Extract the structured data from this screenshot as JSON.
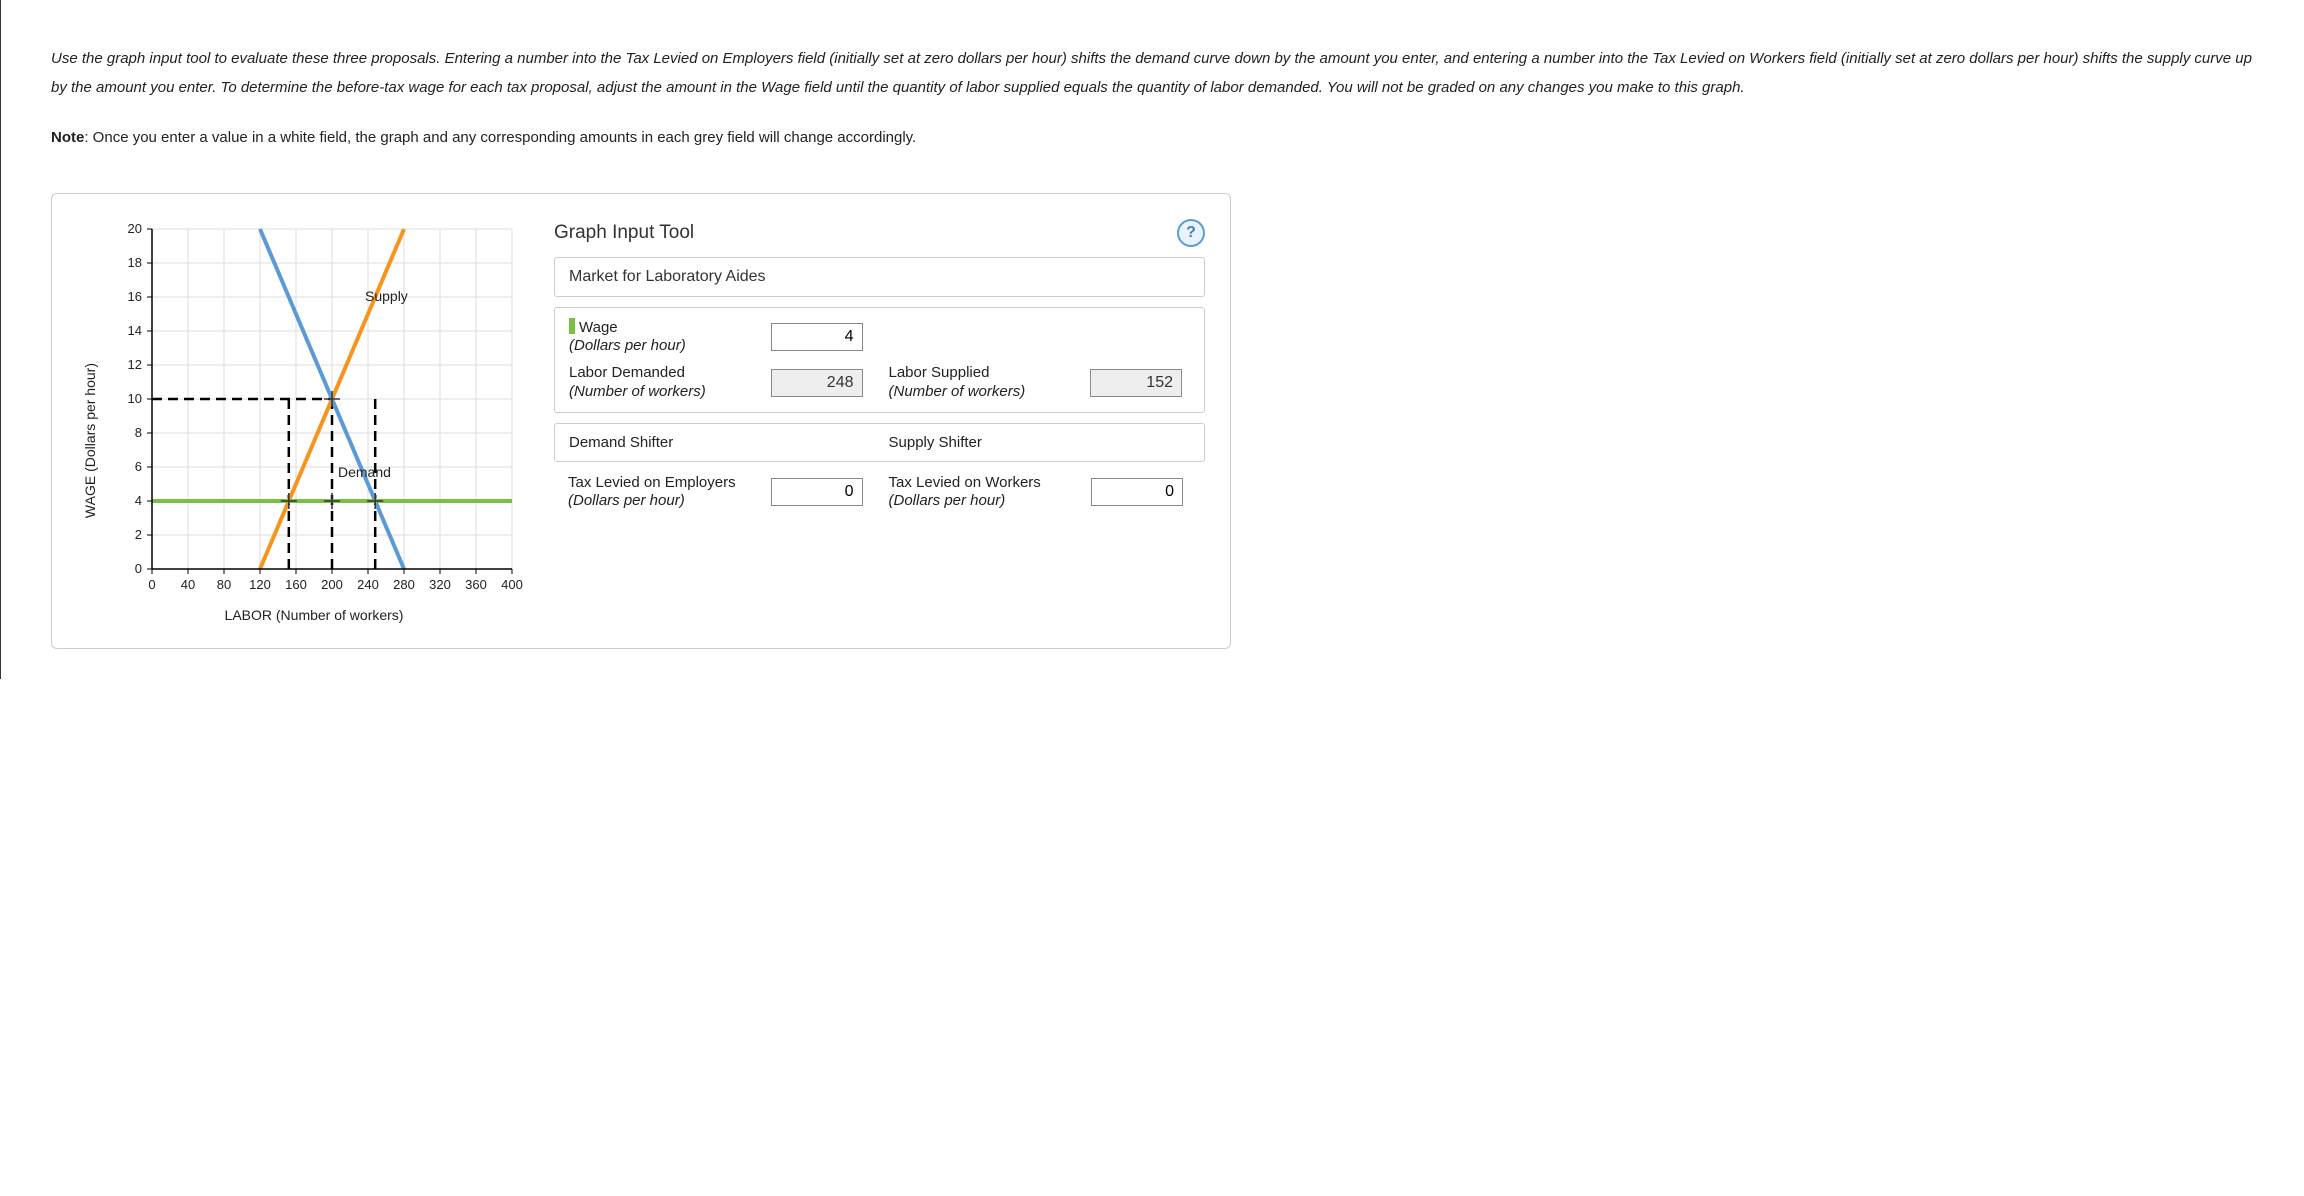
{
  "instructions": "Use the graph input tool to evaluate these three proposals. Entering a number into the Tax Levied on Employers field (initially set at zero dollars per hour) shifts the demand curve down by the amount you enter, and entering a number into the Tax Levied on Workers field (initially set at zero dollars per hour) shifts the supply curve up by the amount you enter. To determine the before-tax wage for each tax proposal, adjust the amount in the Wage field until the quantity of labor supplied equals the quantity of labor demanded. You will not be graded on any changes you make to this graph.",
  "note_label": "Note",
  "note_body": ": Once you enter a value in a white field, the graph and any corresponding amounts in each grey field will change accordingly.",
  "panel": {
    "title": "Graph Input Tool",
    "help": "?",
    "market_title": "Market for Laboratory Aides",
    "wage_label": "Wage",
    "wage_sub": "(Dollars per hour)",
    "wage_value": "4",
    "labor_demanded_label": "Labor Demanded",
    "labor_demanded_sub": "(Number of workers)",
    "labor_demanded_value": "248",
    "labor_supplied_label": "Labor Supplied",
    "labor_supplied_sub": "(Number of workers)",
    "labor_supplied_value": "152",
    "demand_shifter_title": "Demand Shifter",
    "supply_shifter_title": "Supply Shifter",
    "tax_employers_label": "Tax Levied on Employers",
    "tax_employers_sub": "(Dollars per hour)",
    "tax_employers_value": "0",
    "tax_workers_label": "Tax Levied on Workers",
    "tax_workers_sub": "(Dollars per hour)",
    "tax_workers_value": "0"
  },
  "chart_data": {
    "type": "line",
    "title": "",
    "xlabel": "LABOR (Number of workers)",
    "ylabel": "WAGE (Dollars per hour)",
    "xlim": [
      0,
      400
    ],
    "ylim": [
      0,
      20
    ],
    "x_ticks": [
      0,
      40,
      80,
      120,
      160,
      200,
      240,
      280,
      320,
      360,
      400
    ],
    "y_ticks": [
      0,
      2,
      4,
      6,
      8,
      10,
      12,
      14,
      16,
      18,
      20
    ],
    "series": [
      {
        "name": "Supply",
        "color": "#f7941d",
        "points": [
          [
            120,
            0
          ],
          [
            280,
            20
          ]
        ]
      },
      {
        "name": "Demand",
        "color": "#5b9bd5",
        "points": [
          [
            120,
            20
          ],
          [
            280,
            0
          ]
        ]
      },
      {
        "name": "Wage",
        "color": "#7ac142",
        "points": [
          [
            0,
            4
          ],
          [
            400,
            4
          ]
        ]
      }
    ],
    "equilibrium": {
      "x": 200,
      "y": 10
    },
    "guide_dashes": [
      {
        "from": [
          0,
          10
        ],
        "to": [
          200,
          10
        ]
      },
      {
        "from": [
          152,
          0
        ],
        "to": [
          152,
          10
        ]
      },
      {
        "from": [
          200,
          0
        ],
        "to": [
          200,
          10
        ]
      },
      {
        "from": [
          248,
          0
        ],
        "to": [
          248,
          10
        ]
      }
    ],
    "handles": [
      {
        "on": "Supply",
        "at": [
          232,
          14
        ]
      },
      {
        "on": "Demand",
        "at": [
          168,
          14
        ]
      },
      {
        "on": "Wage",
        "at_pixels": "left-right-center"
      }
    ],
    "curve_labels": {
      "supply": "Supply",
      "demand": "Demand"
    }
  }
}
